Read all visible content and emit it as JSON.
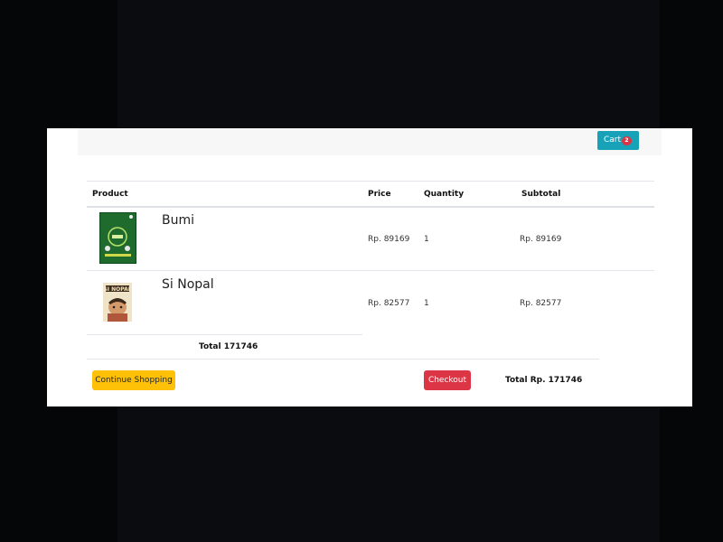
{
  "header": {
    "cart_label": "Cart",
    "cart_count": "2"
  },
  "table": {
    "columns": [
      "Product",
      "Price",
      "Quantity",
      "Subtotal"
    ],
    "rows": [
      {
        "name": "Bumi",
        "price": "Rp. 89169",
        "quantity": "1",
        "subtotal": "Rp. 89169",
        "image": "bumi-book-cover"
      },
      {
        "name": "Si Nopal",
        "price": "Rp. 82577",
        "quantity": "1",
        "subtotal": "Rp. 82577",
        "image": "si-nopal-book-cover"
      }
    ],
    "total_label": "Total 171746"
  },
  "footer": {
    "continue_label": "Continue Shopping",
    "checkout_label": "Checkout",
    "total_label": "Total Rp. 171746"
  },
  "colors": {
    "cart_button": "#17a2b8",
    "badge": "#dc3545",
    "continue_button": "#ffc107",
    "checkout_button": "#dc3545"
  }
}
